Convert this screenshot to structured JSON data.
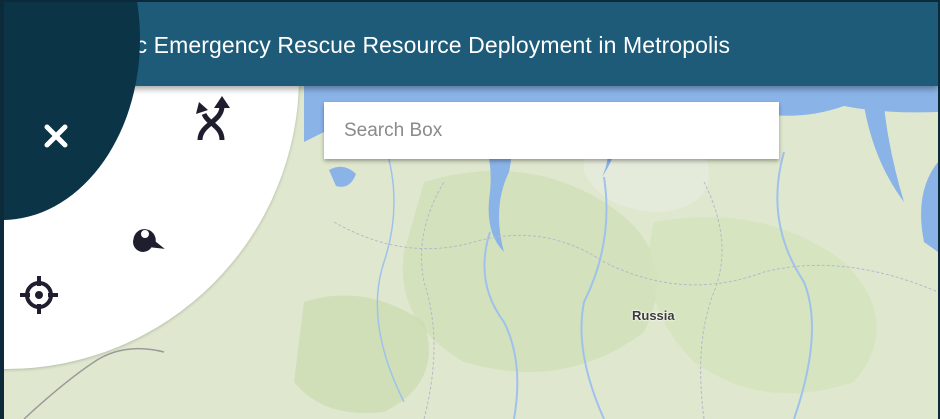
{
  "header": {
    "title": "Automatic Emergency Rescue Resource Deployment in Metropolis"
  },
  "search": {
    "placeholder": "Search Box",
    "value": ""
  },
  "map": {
    "country_label": "Russia"
  },
  "radial_menu": {
    "buttons": [
      {
        "icon": "close-icon"
      },
      {
        "icon": "route-icon"
      },
      {
        "icon": "map-pin-icon"
      },
      {
        "icon": "crosshair-icon"
      }
    ]
  },
  "colors": {
    "header": "#1d5b79",
    "menu_center": "#0b3447",
    "land": "#dfe8cf",
    "water": "#8ab4e8"
  }
}
